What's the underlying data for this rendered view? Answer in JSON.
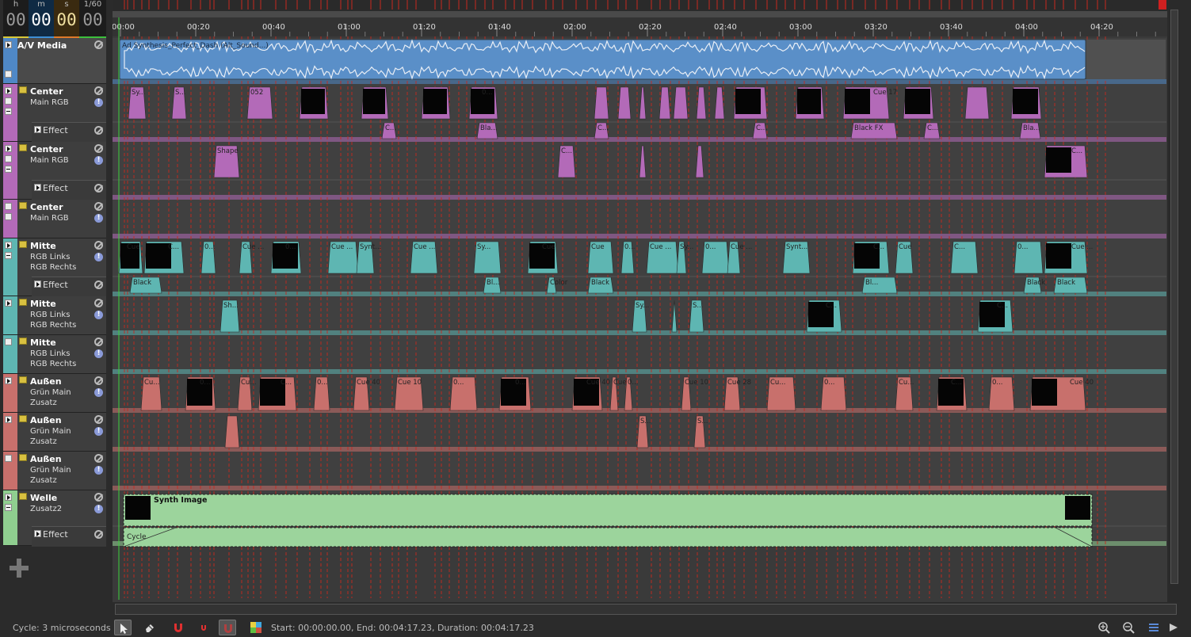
{
  "timecode": {
    "units": [
      "h",
      "m",
      "s",
      "1/60"
    ],
    "values": [
      "00",
      "00",
      "00",
      "00"
    ],
    "bar_colors": [
      "#d8c838",
      "#3d8fd6",
      "#e07a2a",
      "#3cc03c"
    ]
  },
  "ruler": {
    "labels": [
      "00:00",
      "00:20",
      "00:40",
      "01:00",
      "01:20",
      "01:40",
      "02:00",
      "02:20",
      "02:40",
      "03:00",
      "03:20",
      "03:40",
      "04:00",
      "04:20"
    ]
  },
  "tracks": [
    {
      "name": "A/V Media",
      "subs": [],
      "color": "#4f88c6",
      "clip_title": "Ad Synthesis_Perfect_Dash (Alt_Sound...)",
      "effect_label": ""
    },
    {
      "name": "Center",
      "subs": [
        "Main RGB"
      ],
      "color": "#b36ab8",
      "effect_label": "Effect"
    },
    {
      "name": "Center",
      "subs": [
        "Main RGB"
      ],
      "color": "#b36ab8",
      "effect_label": "Effect"
    },
    {
      "name": "Center",
      "subs": [
        "Main RGB"
      ],
      "color": "#b36ab8",
      "effect_label": ""
    },
    {
      "name": "Mitte",
      "subs": [
        "RGB Links",
        "RGB Rechts"
      ],
      "color": "#5eb6b2",
      "effect_label": "Effect"
    },
    {
      "name": "Mitte",
      "subs": [
        "RGB Links",
        "RGB Rechts"
      ],
      "color": "#5eb6b2",
      "effect_label": ""
    },
    {
      "name": "Mitte",
      "subs": [
        "RGB Links",
        "RGB Rechts"
      ],
      "color": "#5eb6b2",
      "effect_label": ""
    },
    {
      "name": "Außen",
      "subs": [
        "Grün Main",
        "Zusatz"
      ],
      "color": "#c8706c",
      "effect_label": ""
    },
    {
      "name": "Außen",
      "subs": [
        "Grün Main",
        "Zusatz"
      ],
      "color": "#c8706c",
      "effect_label": ""
    },
    {
      "name": "Außen",
      "subs": [
        "Grün Main",
        "Zusatz"
      ],
      "color": "#c8706c",
      "effect_label": ""
    },
    {
      "name": "Welle",
      "subs": [
        "Zusatz2"
      ],
      "color": "#8fce8f",
      "effect_label": "Effect"
    }
  ],
  "clips": {
    "center1": [
      "Sy...",
      "S...",
      "052",
      "0...",
      "Cue 17"
    ],
    "center1_fx": [
      "C...",
      "Bla...",
      "C...",
      "C...",
      "Black FX",
      "C...",
      "Bla..."
    ],
    "center2": [
      "Shape",
      "C...",
      "C..."
    ],
    "mitte1": [
      "Cue",
      "C...",
      "0...",
      "Cue ...",
      "0...",
      "Cue ...",
      "Synt...",
      "Cue ...",
      "Sy...",
      "Cue",
      "Cue",
      "0...",
      "Cue ...",
      "Sy...",
      "0...",
      "Cue ...",
      "Synt...",
      "C..."
    ],
    "mitte1_fx": [
      "Black",
      "Bl...",
      "Color",
      "Black",
      "Bl...",
      "Black"
    ],
    "mitte2": [
      "Sh...",
      "Sy...",
      "S...",
      "C...",
      "C..."
    ],
    "aussen1": [
      "Cu...",
      "0...",
      "Cu...",
      "C...",
      "0...",
      "Cue 40",
      "Cue 10",
      "0...",
      "0...",
      "Cue 40",
      "Cue",
      "0...",
      "Cue 10",
      "Cue 28"
    ],
    "aussen2": [
      "",
      "S...",
      "S..."
    ],
    "welle": "Synth Image",
    "welle_fx": "Cycle"
  },
  "status": {
    "cycle": "Cycle: 3 microseconds",
    "range": "Start: 00:00:00.00,  End: 00:04:17.23,  Duration: 00:04:17.23"
  }
}
